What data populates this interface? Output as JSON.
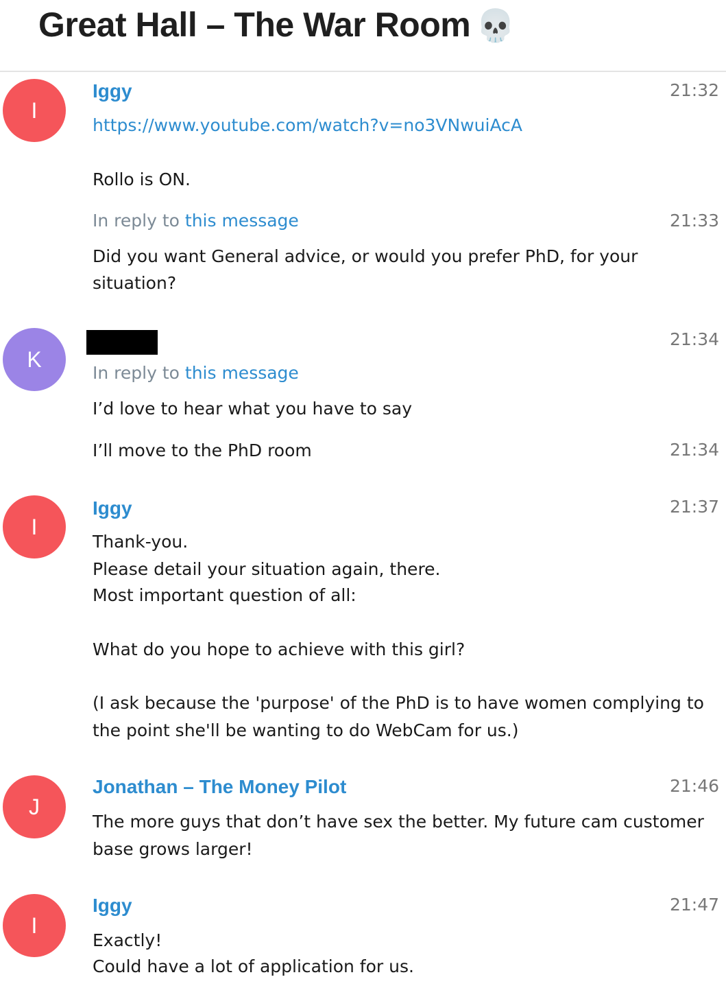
{
  "header": {
    "title": "Great Hall – The War Room",
    "emoji": "💀"
  },
  "colors": {
    "avatar_red": "#f5555a",
    "avatar_purple": "#9b84e6",
    "link_blue": "#2d8ccf",
    "muted_gray": "#777777"
  },
  "avatars": {
    "i": "I",
    "k": "K",
    "j": "J"
  },
  "messages": {
    "m1": {
      "sender": "Iggy",
      "time": "21:32",
      "link": "https://www.youtube.com/watch?v=no3VNwuiAcA"
    },
    "m2": {
      "text": "Rollo is ON."
    },
    "m3": {
      "reply_prefix": "In reply to",
      "reply_link": "this message",
      "time": "21:33",
      "line1": "Did you want General advice, or would you prefer PhD, for your",
      "line2": "situation?"
    },
    "m4": {
      "time": "21:34",
      "reply_prefix": "In reply to",
      "reply_link": "this message",
      "text": "I’d love to hear what you have to say"
    },
    "m5": {
      "text": "I’ll move to the PhD room",
      "time": "21:34"
    },
    "m6": {
      "sender": "Iggy",
      "time": "21:37",
      "line1": "Thank-you.",
      "line2": "Please detail your situation again, there.",
      "line3": "Most important question of all:",
      "line4": "What do you hope to achieve with this girl?",
      "line5": "(I ask because the 'purpose' of the PhD is to have women complying to",
      "line6": "the point she'll be wanting to do WebCam for us.)"
    },
    "m7": {
      "sender": "Jonathan – The Money Pilot",
      "time": "21:46",
      "line1": "The more guys that don’t have sex the better. My future cam customer",
      "line2": "base grows larger!"
    },
    "m8": {
      "sender": "Iggy",
      "time": "21:47",
      "line1": "Exactly!",
      "line2": "Could have a lot of application for us."
    }
  }
}
